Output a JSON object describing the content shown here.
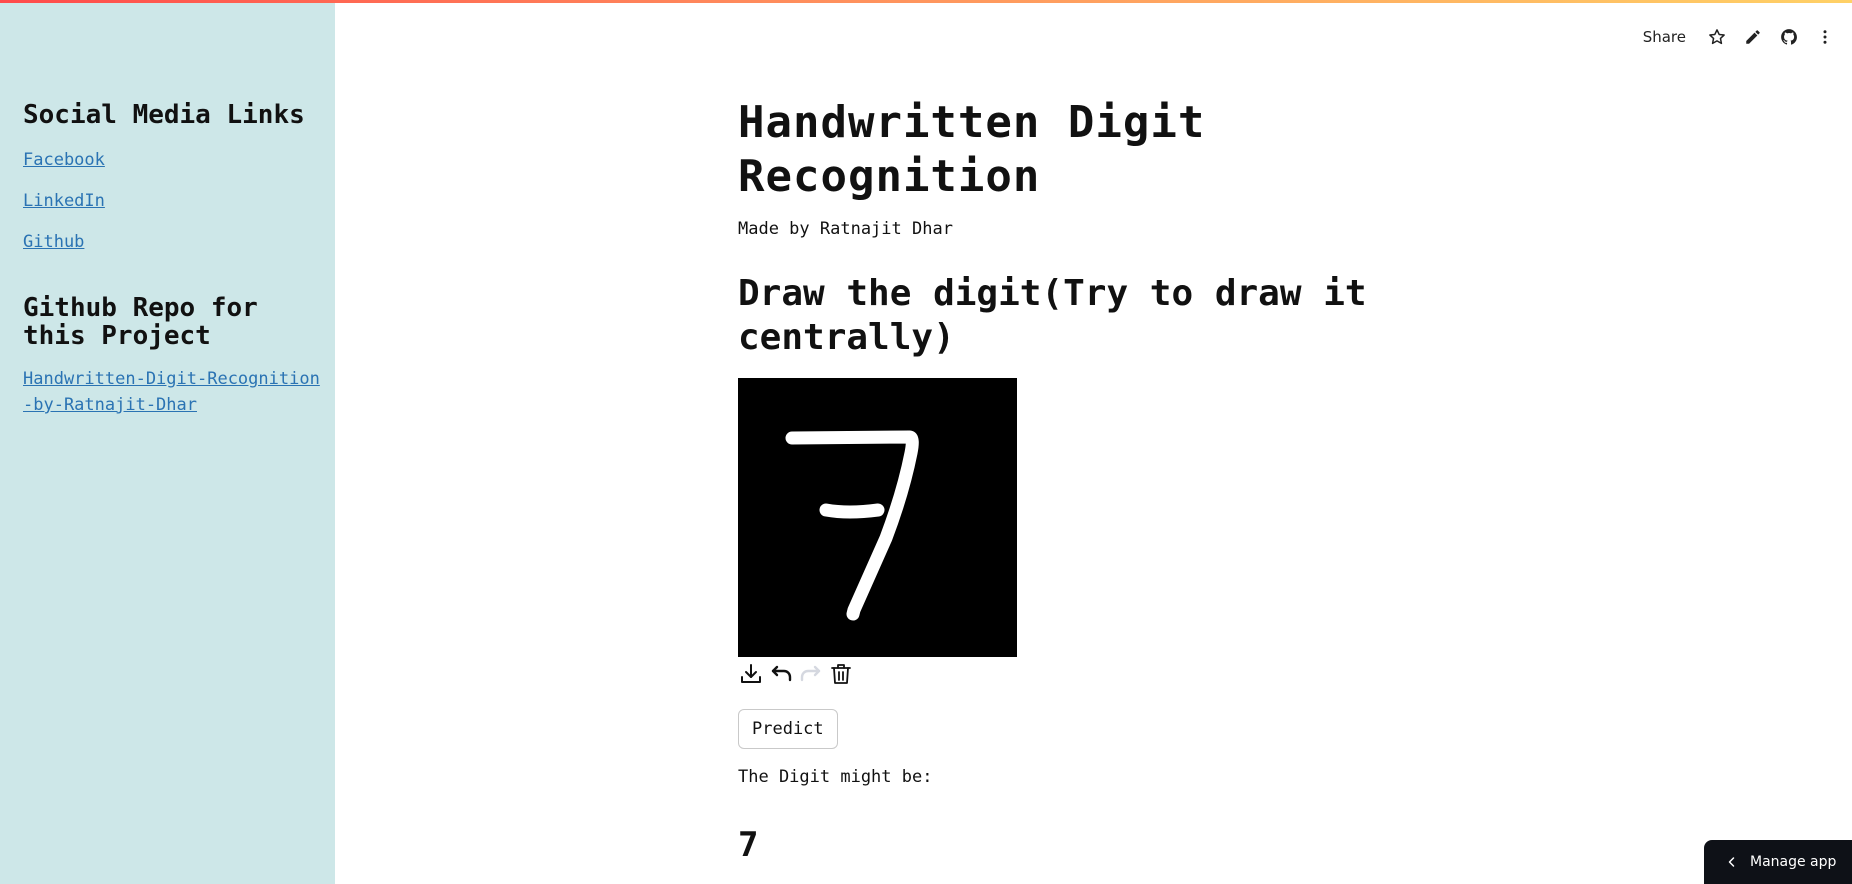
{
  "sidebar": {
    "title": "Social Media Links",
    "links": [
      "Facebook",
      "LinkedIn",
      "Github"
    ],
    "repo_title": "Github Repo for this Project",
    "repo_link": "Handwritten-Digit-Recognition-by-Ratnajit-Dhar"
  },
  "toolbar": {
    "share_label": "Share",
    "icons": [
      "star-icon",
      "pencil-icon",
      "github-icon",
      "more-vertical-icon"
    ]
  },
  "main": {
    "title": "Handwritten Digit Recognition",
    "author": "Made by Ratnajit Dhar",
    "subhead": "Draw the digit(Try to draw it centrally)",
    "canvas_tools": [
      "download-icon",
      "undo-icon",
      "redo-icon",
      "trash-icon"
    ],
    "predict_label": "Predict",
    "result_label": "The Digit might be:",
    "result_value": "7"
  },
  "footer": {
    "manage_label": "Manage app"
  },
  "colors": {
    "sidebar_bg": "#cde7e8",
    "link": "#2a73b3",
    "canvas_bg": "#000000",
    "stroke": "#ffffff",
    "manage_bg": "#0e1117"
  }
}
